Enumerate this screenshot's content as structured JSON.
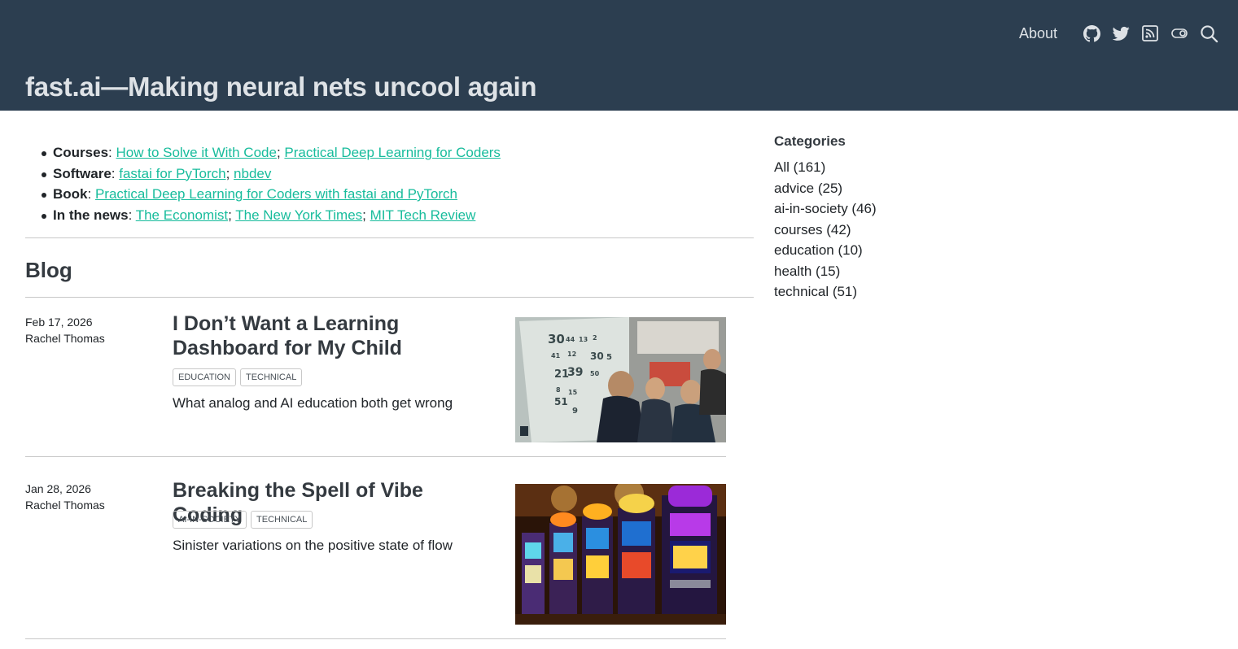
{
  "header": {
    "title": "fast.ai—Making neural nets uncool again",
    "about": "About",
    "icons": [
      "github-icon",
      "twitter-icon",
      "rss-icon",
      "toggle-icon",
      "search-icon"
    ]
  },
  "intro": {
    "courses_label": "Courses",
    "courses_links": [
      "How to Solve it With Code",
      "Practical Deep Learning for Coders"
    ],
    "software_label": "Software",
    "software_links": [
      "fastai for PyTorch",
      "nbdev"
    ],
    "book_label": "Book",
    "book_link": "Practical Deep Learning for Coders with fastai and PyTorch",
    "news_label": "In the news",
    "news_links": [
      "The Economist",
      "The New York Times",
      "MIT Tech Review"
    ]
  },
  "blog": {
    "heading": "Blog",
    "posts": [
      {
        "date": "Feb 17, 2026",
        "author": "Rachel Thomas",
        "title": "I Don’t Want a Learning Dashboard for My Child",
        "tags": [
          "EDUCATION",
          "TECHNICAL"
        ],
        "description": "What analog and AI education both get wrong"
      },
      {
        "date": "Jan 28, 2026",
        "author": "Rachel Thomas",
        "title": "Breaking the Spell of Vibe Coding",
        "tags": [
          "AI-IN-SOCIETY",
          "TECHNICAL"
        ],
        "description": "Sinister variations on the positive state of flow"
      }
    ]
  },
  "sidebar": {
    "heading": "Categories",
    "categories": [
      "All (161)",
      "advice (25)",
      "ai-in-society (46)",
      "courses (42)",
      "education (10)",
      "health (15)",
      "technical (51)"
    ]
  },
  "colors": {
    "header_bg": "#2c3e50",
    "link": "#18bc9c",
    "header_text": "#dee2e6"
  }
}
